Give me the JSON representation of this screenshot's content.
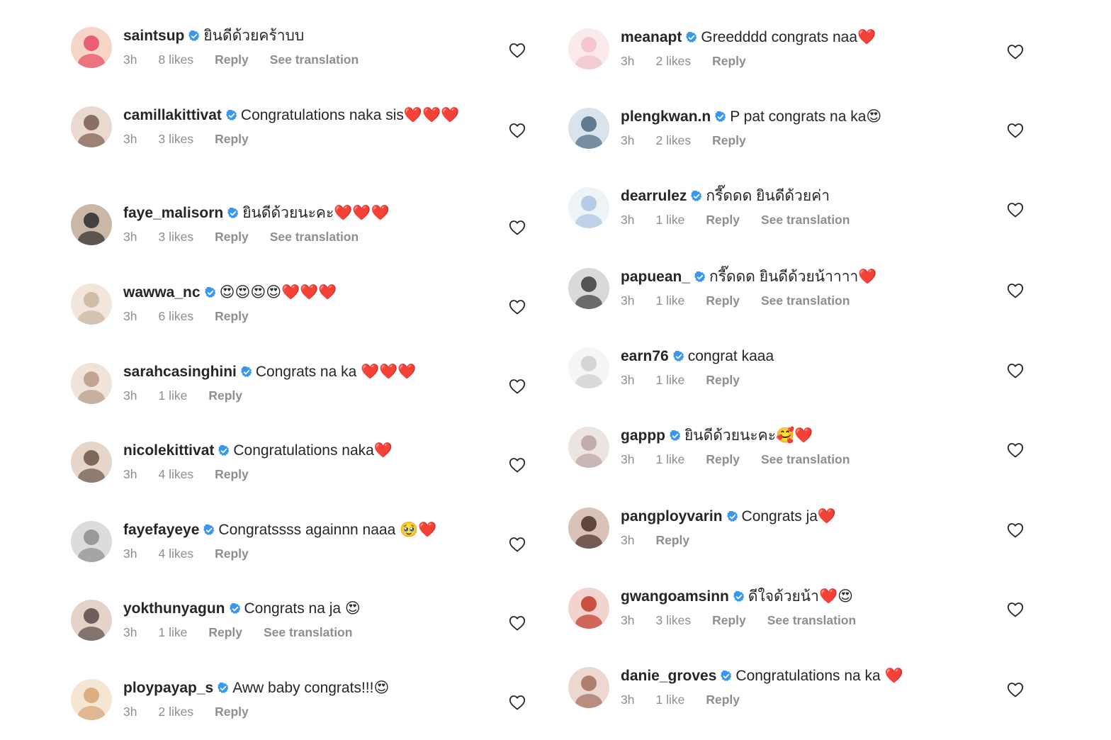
{
  "colors": {
    "username": "#262626",
    "meta": "#8e8e8e",
    "verified": "#3897f0"
  },
  "left_comments": [
    {
      "username": "saintsup",
      "text": "ยินดีด้วยคร้าบบ",
      "time": "3h",
      "likes": "8 likes",
      "reply": "Reply",
      "translation": "See translation"
    },
    {
      "username": "camillakittivat",
      "text": "Congratulations naka sis❤️❤️❤️",
      "time": "3h",
      "likes": "3 likes",
      "reply": "Reply",
      "translation": ""
    },
    {
      "username": "faye_malisorn",
      "text": "ยินดีด้วยนะคะ❤️❤️❤️",
      "time": "3h",
      "likes": "3 likes",
      "reply": "Reply",
      "translation": "See translation"
    },
    {
      "username": "wawwa_nc",
      "text": "😍😍😍😍❤️❤️❤️",
      "time": "3h",
      "likes": "6 likes",
      "reply": "Reply",
      "translation": ""
    },
    {
      "username": "sarahcasinghini",
      "text": "Congrats na ka ❤️❤️❤️",
      "time": "3h",
      "likes": "1 like",
      "reply": "Reply",
      "translation": ""
    },
    {
      "username": "nicolekittivat",
      "text": "Congratulations naka❤️",
      "time": "3h",
      "likes": "4 likes",
      "reply": "Reply",
      "translation": ""
    },
    {
      "username": "fayefayeye",
      "text": "Congratssss againnn naaa 🥹❤️",
      "time": "3h",
      "likes": "4 likes",
      "reply": "Reply",
      "translation": ""
    },
    {
      "username": "yokthunyagun",
      "text": "Congrats na ja 😍",
      "time": "3h",
      "likes": "1 like",
      "reply": "Reply",
      "translation": "See translation"
    },
    {
      "username": "ploypayap_s",
      "text": "Aww baby congrats!!!😍",
      "time": "3h",
      "likes": "2 likes",
      "reply": "Reply",
      "translation": ""
    }
  ],
  "right_comments": [
    {
      "username": "meanapt",
      "text": "Greedddd congrats naa❤️",
      "time": "3h",
      "likes": "2 likes",
      "reply": "Reply",
      "translation": ""
    },
    {
      "username": "plengkwan.n",
      "text": "P pat congrats na ka😍",
      "time": "3h",
      "likes": "2 likes",
      "reply": "Reply",
      "translation": ""
    },
    {
      "username": "dearrulez",
      "text": "กรี๊ดดด ยินดีด้วยค่า",
      "time": "3h",
      "likes": "1 like",
      "reply": "Reply",
      "translation": "See translation"
    },
    {
      "username": "papuean_",
      "text": "กรี๊ดดด ยินดีด้วยน้าาาา❤️",
      "time": "3h",
      "likes": "1 like",
      "reply": "Reply",
      "translation": "See translation"
    },
    {
      "username": "earn76",
      "text": "congrat kaaa",
      "time": "3h",
      "likes": "1 like",
      "reply": "Reply",
      "translation": ""
    },
    {
      "username": "gappp",
      "text": "ยินดีด้วยนะคะ🥰❤️",
      "time": "3h",
      "likes": "1 like",
      "reply": "Reply",
      "translation": "See translation"
    },
    {
      "username": "pangployvarin",
      "text": "Congrats ja❤️",
      "time": "3h",
      "likes": "",
      "reply": "Reply",
      "translation": ""
    },
    {
      "username": "gwangoamsinn",
      "text": "ดีใจด้วยน้า❤️😍",
      "time": "3h",
      "likes": "3 likes",
      "reply": "Reply",
      "translation": "See translation"
    },
    {
      "username": "danie_groves",
      "text": "Congratulations na ka ❤️",
      "time": "3h",
      "likes": "1 like",
      "reply": "Reply",
      "translation": ""
    }
  ]
}
